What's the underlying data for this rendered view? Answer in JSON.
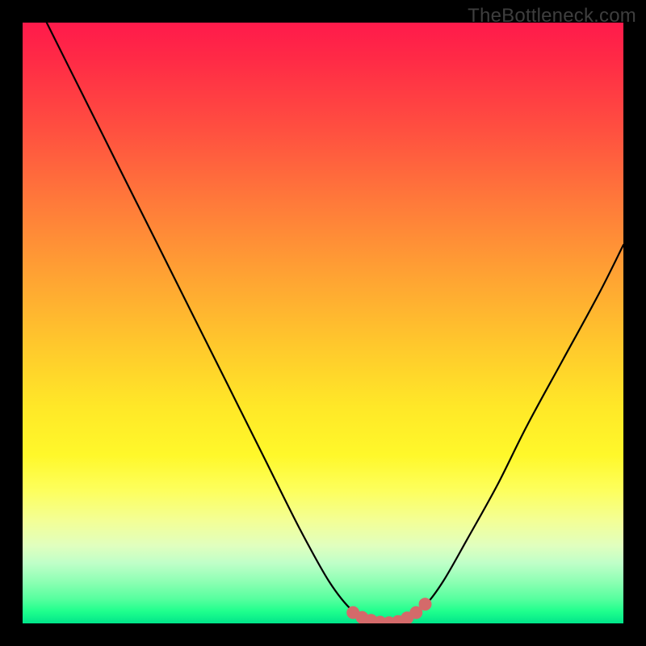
{
  "watermark": "TheBottleneck.com",
  "colors": {
    "frame_bg": "#000000",
    "gradient_top": "#ff1a4b",
    "gradient_mid": "#ffe828",
    "gradient_bottom": "#00e58a",
    "curve_stroke": "#000000",
    "marker_stroke": "#d46a6a",
    "marker_fill": "#d46a6a"
  },
  "chart_data": {
    "type": "line",
    "title": "",
    "xlabel": "",
    "ylabel": "",
    "xlim": [
      0,
      100
    ],
    "ylim": [
      0,
      100
    ],
    "series": [
      {
        "name": "curve",
        "x": [
          4,
          10,
          16,
          22,
          28,
          34,
          40,
          46,
          51,
          55,
          58,
          60,
          62,
          64,
          67,
          70,
          74,
          79,
          84,
          90,
          96,
          100
        ],
        "y": [
          100,
          88,
          76,
          64,
          52,
          40,
          28,
          16,
          7,
          2,
          0.5,
          0,
          0,
          0.8,
          3,
          7,
          14,
          23,
          33,
          44,
          55,
          63
        ]
      }
    ],
    "markers": {
      "name": "optimal-range",
      "x": [
        55,
        56.5,
        58,
        59.5,
        61,
        62.5,
        64,
        65.5,
        67
      ],
      "y": [
        1.8,
        1.0,
        0.5,
        0.2,
        0.1,
        0.3,
        0.9,
        1.8,
        3.2
      ]
    }
  }
}
